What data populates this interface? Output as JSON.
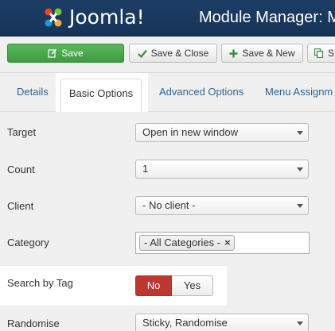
{
  "header": {
    "logo_text": "Joomla!",
    "title": "Module Manager: M"
  },
  "toolbar": {
    "save_label": "Save",
    "save_close_label": "Save & Close",
    "save_new_label": "Save & New",
    "save_copy_label": "S"
  },
  "tabs": [
    {
      "label": "Details"
    },
    {
      "label": "Basic Options",
      "active": true
    },
    {
      "label": "Advanced Options"
    },
    {
      "label": "Menu Assignm"
    }
  ],
  "form": {
    "target": {
      "label": "Target",
      "value": "Open in new window"
    },
    "count": {
      "label": "Count",
      "value": "1"
    },
    "client": {
      "label": "Client",
      "value": "- No client -"
    },
    "category": {
      "label": "Category",
      "chip": "- All Categories -",
      "chip_remove": "×"
    },
    "search_by_tag": {
      "label": "Search by Tag",
      "no_label": "No",
      "yes_label": "Yes",
      "selected": "No"
    },
    "randomise": {
      "label": "Randomise",
      "value": "Sticky, Randomise"
    }
  },
  "colors": {
    "header_bg": "#1c3d66",
    "save_green": "#46a546",
    "toggle_no_red": "#bd362f",
    "link_blue": "#2a6496"
  }
}
